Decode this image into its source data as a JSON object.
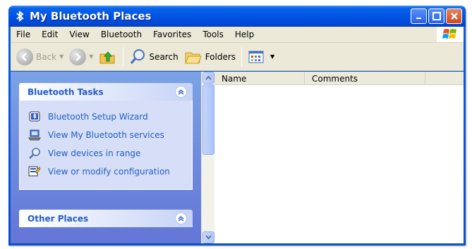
{
  "window": {
    "title": "My Bluetooth Places"
  },
  "menu": [
    "File",
    "Edit",
    "View",
    "Bluetooth",
    "Favorites",
    "Tools",
    "Help"
  ],
  "toolbar": {
    "back_label": "Back",
    "search_label": "Search",
    "folders_label": "Folders"
  },
  "taskpane": {
    "groups": [
      {
        "title": "Bluetooth Tasks",
        "tasks": [
          {
            "label": "Bluetooth Setup Wizard",
            "icon": "bluetooth-wizard-icon"
          },
          {
            "label": "View My Bluetooth services",
            "icon": "computer-icon"
          },
          {
            "label": "View devices in range",
            "icon": "search-icon"
          },
          {
            "label": "View or modify configuration",
            "icon": "configuration-icon"
          }
        ]
      },
      {
        "title": "Other Places",
        "tasks": []
      }
    ]
  },
  "list": {
    "columns": [
      "Name",
      "Comments"
    ]
  },
  "colors": {
    "titlebar": "#0055e5",
    "taskpane_bg": "#6375d6",
    "task_link": "#215dc6"
  }
}
